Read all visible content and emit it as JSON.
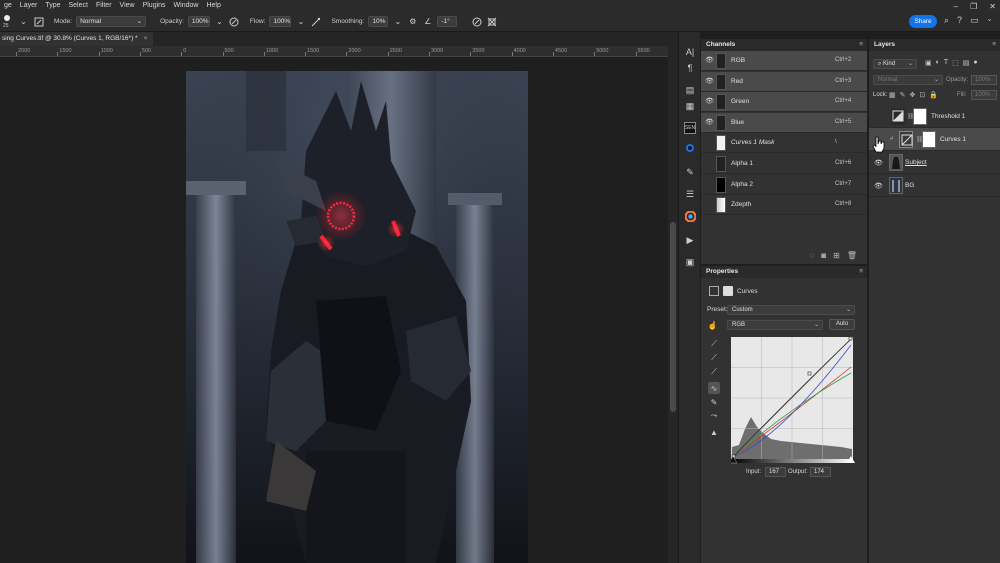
{
  "menu": [
    "ge",
    "Layer",
    "Type",
    "Select",
    "Filter",
    "View",
    "Plugins",
    "Window",
    "Help"
  ],
  "options": {
    "brush_size": "25",
    "mode_label": "Mode:",
    "mode_value": "Normal",
    "opacity_label": "Opacity:",
    "opacity_value": "100%",
    "flow_label": "Flow:",
    "flow_value": "100%",
    "smoothing_label": "Smoothing:",
    "smoothing_value": "10%",
    "angle_value": "-1°",
    "share_label": "Share"
  },
  "document": {
    "tab_title": "sing Curves.tif @ 30.8% (Curves 1, RGB/16*) *",
    "close": "×"
  },
  "ruler": {
    "labels": [
      "2000",
      "1500",
      "1000",
      "500",
      "0",
      "500",
      "1000",
      "1500",
      "2000",
      "2500",
      "3000",
      "3500",
      "4000",
      "4500",
      "5000",
      "5500"
    ]
  },
  "channels": {
    "title": "Channels",
    "rows": [
      {
        "name": "RGB",
        "shortcut": "Ctrl+2",
        "thumb": "dark"
      },
      {
        "name": "Red",
        "shortcut": "Ctrl+3",
        "thumb": "dark"
      },
      {
        "name": "Green",
        "shortcut": "Ctrl+4",
        "thumb": "dark"
      },
      {
        "name": "Blue",
        "shortcut": "Ctrl+5",
        "thumb": "dark"
      },
      {
        "name": "Curves 1 Mask",
        "shortcut": "\\",
        "thumb": "white"
      },
      {
        "name": "Alpha 1",
        "shortcut": "Ctrl+6",
        "thumb": "dark"
      },
      {
        "name": "Alpha 2",
        "shortcut": "Ctrl+7",
        "thumb": "black"
      },
      {
        "name": "Zdepth",
        "shortcut": "Ctrl+8",
        "thumb": "grad"
      }
    ]
  },
  "properties": {
    "title": "Properties",
    "adjustment_name": "Curves",
    "preset_label": "Preset:",
    "preset_value": "Custom",
    "channel_value": "RGB",
    "auto_label": "Auto",
    "input_label": "Input:",
    "input_value": "167",
    "output_label": "Output:",
    "output_value": "174"
  },
  "layers": {
    "title": "Layers",
    "kind_label": "Kind",
    "blend_mode": "Normal",
    "opacity_label": "Opacity:",
    "opacity_value": "100%",
    "lock_label": "Lock:",
    "fill_label": "Fill:",
    "fill_value": "100%",
    "rows": [
      {
        "name": "Threshold 1",
        "visible": false
      },
      {
        "name": "Curves 1",
        "visible": false
      },
      {
        "name": "Subject",
        "visible": true
      },
      {
        "name": "BG",
        "visible": true
      }
    ]
  },
  "colors": {
    "accent": "#1473e6",
    "glow": "#ff1a2a",
    "panel_bg": "#323232",
    "selection_bg": "#4a4a4a"
  }
}
